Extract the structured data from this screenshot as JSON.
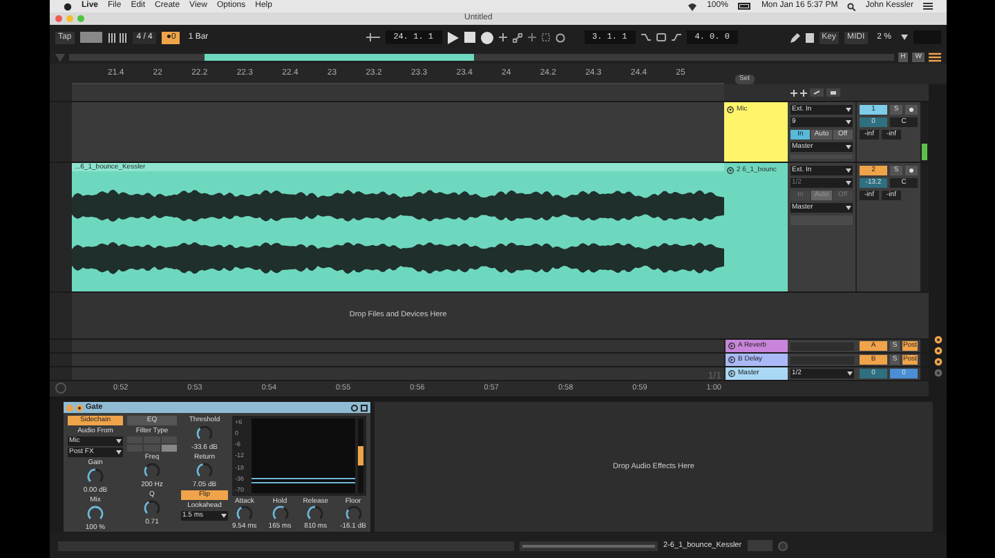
{
  "menu_bar": {
    "app": "Live",
    "items": [
      "File",
      "Edit",
      "Create",
      "View",
      "Options",
      "Help"
    ],
    "battery": "100%",
    "clock": "Mon Jan 16  5:37 PM",
    "user": "John Kessler"
  },
  "window": {
    "title": "Untitled"
  },
  "control_bar": {
    "tap": "Tap",
    "signature": "4 / 4",
    "metronome": "●0",
    "quantize": "1 Bar",
    "position": "24.  1.  1",
    "loop_start": "3.  1.  1",
    "loop_length": "4.  0.  0",
    "key": "Key",
    "midi": "MIDI",
    "cpu": "2 %"
  },
  "overview": {
    "h": "H",
    "w": "W"
  },
  "ruler": [
    "21.4",
    "22",
    "22.2",
    "22.3",
    "22.4",
    "23",
    "23.2",
    "23.3",
    "23.4",
    "24",
    "24.2",
    "24.3",
    "24.4",
    "25"
  ],
  "set_label": "Set",
  "tracks": [
    {
      "name": "Mic",
      "color": "#fff56b",
      "selected": true,
      "input_type": "Ext. In",
      "input_channel": "9",
      "monitor_disabled": false,
      "monitor": [
        {
          "label": "In",
          "selected": true
        },
        {
          "label": "Auto",
          "selected": false
        },
        {
          "label": "Off",
          "selected": false
        }
      ],
      "output": "Master",
      "number": "1",
      "solo": "S",
      "volume": "0",
      "pan": "C",
      "peak_left": "-inf",
      "peak_right": "-inf"
    },
    {
      "name": "2 6_1_bounc",
      "color": "#6ed8bf",
      "selected": false,
      "input_type": "Ext. In",
      "input_channel": "1/2",
      "monitor_disabled": true,
      "monitor": [
        {
          "label": "In",
          "selected": false
        },
        {
          "label": "Auto",
          "selected": true
        },
        {
          "label": "Off",
          "selected": false
        }
      ],
      "output": "Master",
      "number": "2",
      "solo": "S",
      "volume": "-13.2",
      "pan": "C",
      "peak_left": "-inf",
      "peak_right": "-inf",
      "clip": {
        "name": "...6_1_bounce_Kessler"
      }
    }
  ],
  "drop_hint": "Drop Files and Devices Here",
  "returns": [
    {
      "name": "A Reverb",
      "color": "#c985dc",
      "letter": "A",
      "solo": "S",
      "mode": "Post"
    },
    {
      "name": "B Delay",
      "color": "#aab9f7",
      "letter": "B",
      "solo": "S",
      "mode": "Post"
    }
  ],
  "master": {
    "name": "Master",
    "color": "#a9d8f5",
    "output": "1/2",
    "volume": "0",
    "pan": "0"
  },
  "time_ruler": {
    "ticks": [
      "0:52",
      "0:53",
      "0:54",
      "0:55",
      "0:56",
      "0:57",
      "0:58",
      "0:59",
      "1:00"
    ],
    "zoom": "1/1"
  },
  "device": {
    "name": "Gate",
    "sidechain": {
      "label": "Sidechain",
      "on": true
    },
    "eq": {
      "label": "EQ",
      "on": false
    },
    "audio_from_label": "Audio From",
    "audio_from": "Mic",
    "tap_point": "Post FX",
    "filter_type_label": "Filter Type",
    "filter_shapes": [
      {
        "selected": false
      },
      {
        "selected": false
      },
      {
        "selected": false
      },
      {
        "selected": false
      },
      {
        "selected": false
      },
      {
        "selected": true
      }
    ],
    "gain_label": "Gain",
    "gain": "0.00 dB",
    "mix_label": "Mix",
    "mix": "100 %",
    "freq_label": "Freq",
    "freq": "200 Hz",
    "q_label": "Q",
    "q": "0.71",
    "threshold_label": "Threshold",
    "threshold": "-33.6 dB",
    "return_label": "Return",
    "return": "7.05 dB",
    "flip": {
      "label": "Flip",
      "on": true
    },
    "lookahead_label": "Lookahead",
    "lookahead": "1.5 ms",
    "attack_label": "Attack",
    "attack": "9.54 ms",
    "hold_label": "Hold",
    "hold": "165 ms",
    "release_label": "Release",
    "release": "810 ms",
    "floor_label": "Floor",
    "floor": "-16.1 dB",
    "scale": [
      "+6",
      "0",
      "-6",
      "-12",
      "-18",
      "-36",
      "-70"
    ]
  },
  "effects_drop_hint": "Drop Audio Effects Here",
  "status": {
    "clip": "2-6_1_bounce_Kessler"
  }
}
